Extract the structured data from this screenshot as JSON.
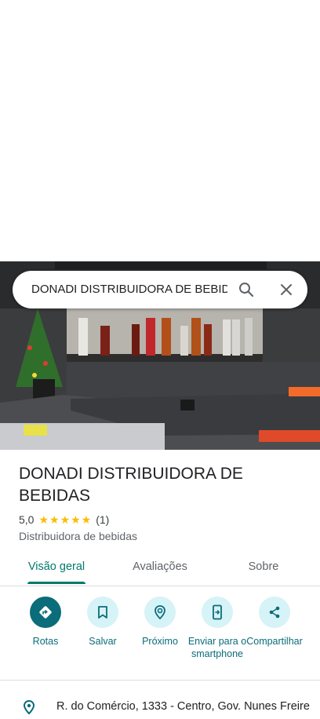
{
  "search": {
    "value": "DONADI DISTRIBUIDORA DE BEBIDAS"
  },
  "place": {
    "name": "DONADI DISTRIBUIDORA DE BEBIDAS",
    "rating": "5,0",
    "stars": "★★★★★",
    "review_count": "(1)",
    "category": "Distribuidora de bebidas"
  },
  "tabs": [
    {
      "label": "Visão geral",
      "active": true
    },
    {
      "label": "Avaliações",
      "active": false
    },
    {
      "label": "Sobre",
      "active": false
    }
  ],
  "actions": [
    {
      "label": "Rotas",
      "icon": "directions-icon"
    },
    {
      "label": "Salvar",
      "icon": "bookmark-icon"
    },
    {
      "label": "Próximo",
      "icon": "nearby-icon"
    },
    {
      "label": "Enviar para o smartphone",
      "icon": "send-to-phone-icon"
    },
    {
      "label": "Compartilhar",
      "icon": "share-icon"
    }
  ],
  "address": "R. do Comércio, 1333 - Centro, Gov. Nunes Freire",
  "colors": {
    "accent": "#00796b",
    "action_bg": "#d6f3f7",
    "primary_action": "#0b6c7a",
    "star": "#fbbc04"
  }
}
